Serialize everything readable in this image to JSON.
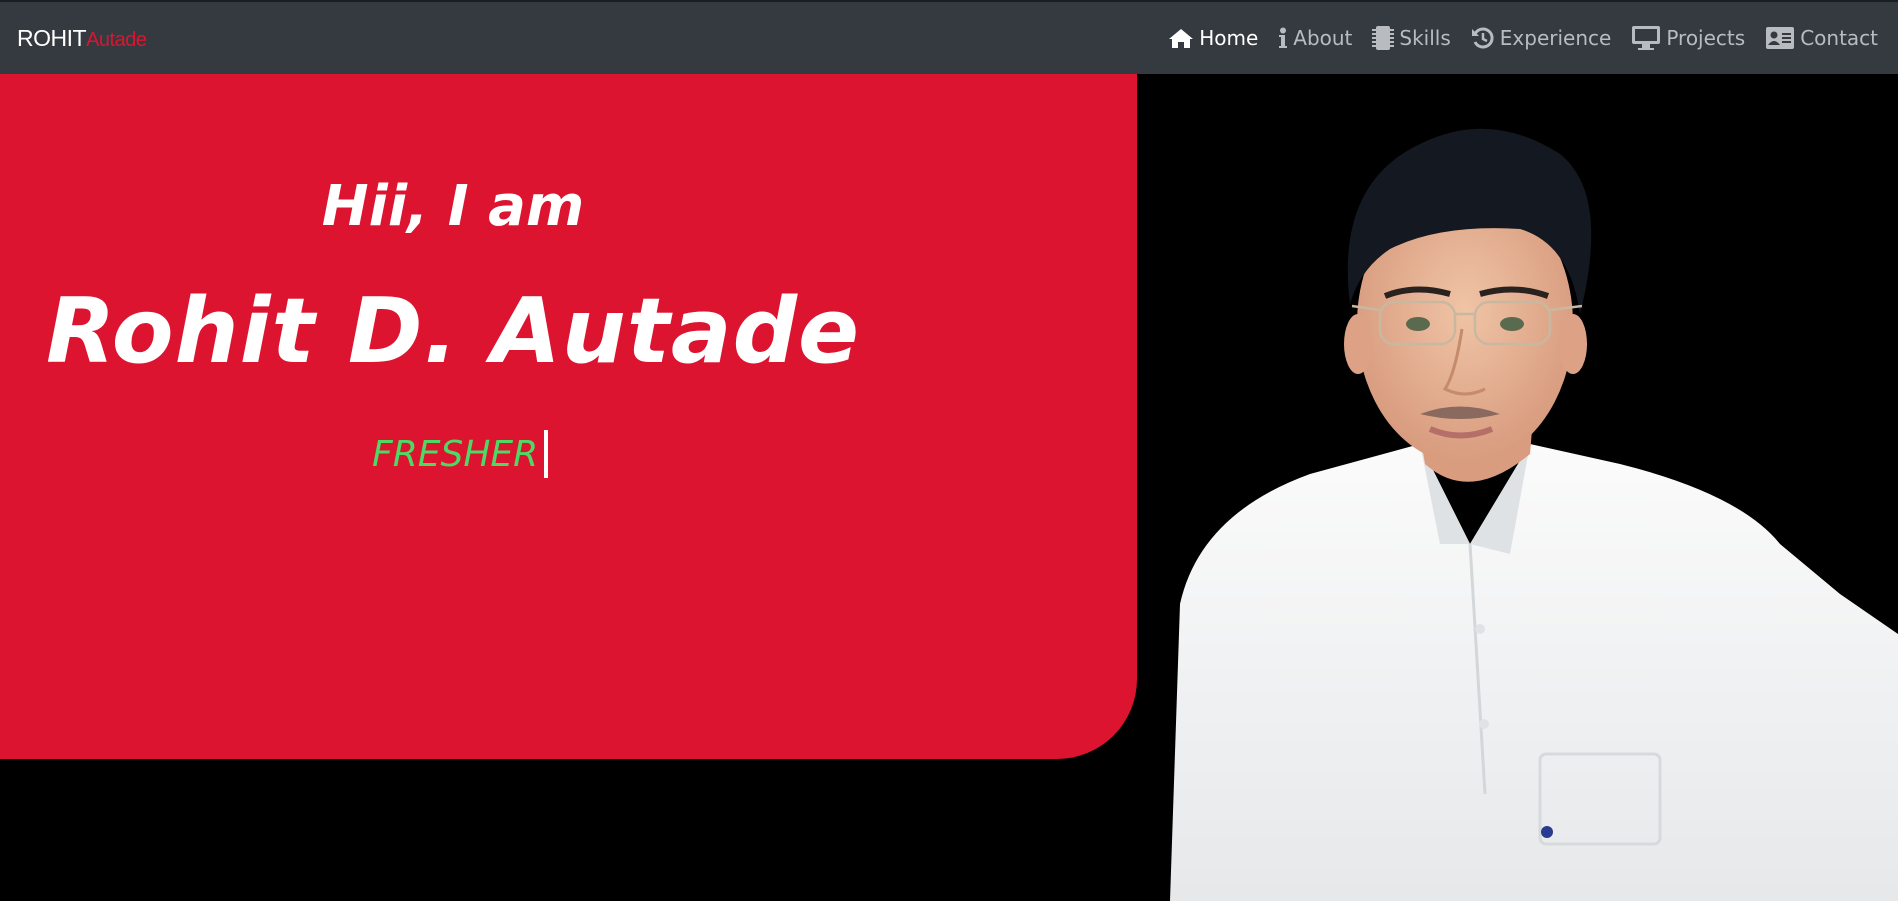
{
  "brand": {
    "first": "ROHIT",
    "last": "Autade"
  },
  "nav": {
    "items": [
      {
        "label": "Home",
        "icon": "home-icon",
        "active": true
      },
      {
        "label": "About",
        "icon": "info-icon",
        "active": false
      },
      {
        "label": "Skills",
        "icon": "chip-icon",
        "active": false
      },
      {
        "label": "Experience",
        "icon": "history-icon",
        "active": false
      },
      {
        "label": "Projects",
        "icon": "desktop-icon",
        "active": false
      },
      {
        "label": "Contact",
        "icon": "id-card-icon",
        "active": false
      }
    ]
  },
  "hero": {
    "greeting": "Hii, I am",
    "name": "Rohit D. Autade",
    "role": "FRESHER"
  },
  "colors": {
    "navbar": "#343a40",
    "accent": "#dc1430",
    "role_text": "#4cd964",
    "background": "#000000"
  }
}
